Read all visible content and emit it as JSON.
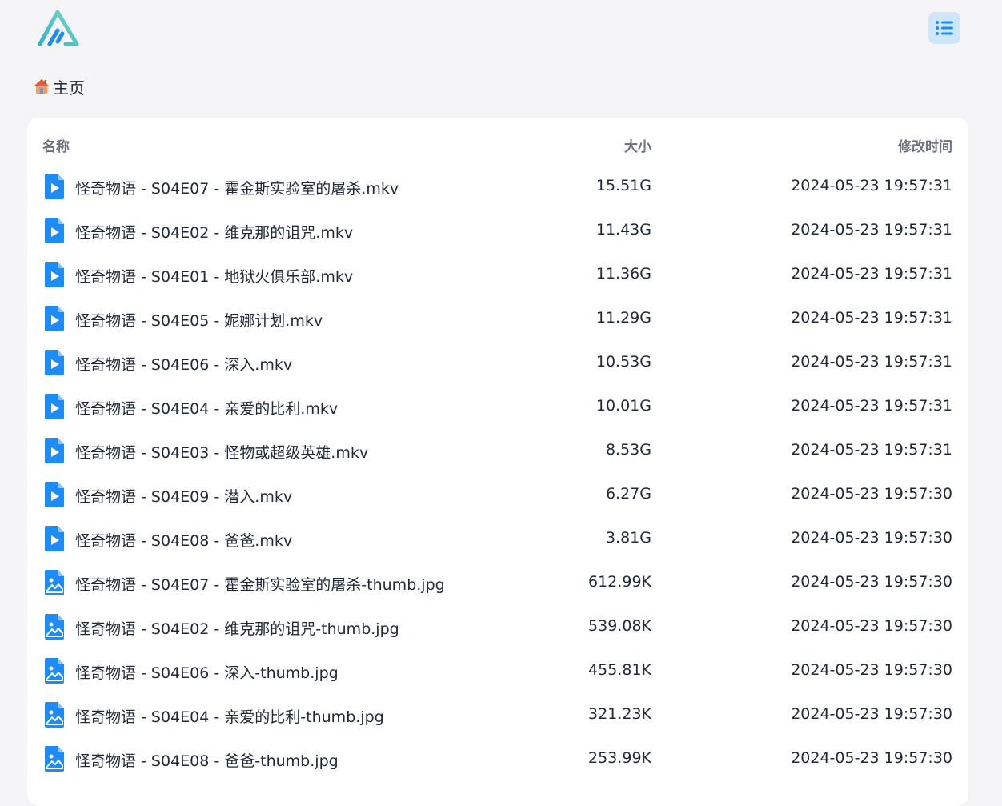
{
  "header": {
    "logo_icon": "app-logo-icon",
    "menu_icon": "list-menu-icon"
  },
  "breadcrumb": {
    "home_icon": "house-icon",
    "label": "主页"
  },
  "table": {
    "columns": {
      "name": "名称",
      "size": "大小",
      "modified": "修改时间"
    },
    "rows": [
      {
        "name": "怪奇物语 - S04E07 - 霍金斯实验室的屠杀.mkv",
        "size": "15.51G",
        "modified": "2024-05-23 19:57:31",
        "icon": "video-file-icon"
      },
      {
        "name": "怪奇物语 - S04E02 - 维克那的诅咒.mkv",
        "size": "11.43G",
        "modified": "2024-05-23 19:57:31",
        "icon": "video-file-icon"
      },
      {
        "name": "怪奇物语 - S04E01 - 地狱火俱乐部.mkv",
        "size": "11.36G",
        "modified": "2024-05-23 19:57:31",
        "icon": "video-file-icon"
      },
      {
        "name": "怪奇物语 - S04E05 - 妮娜计划.mkv",
        "size": "11.29G",
        "modified": "2024-05-23 19:57:31",
        "icon": "video-file-icon"
      },
      {
        "name": "怪奇物语 - S04E06 - 深入.mkv",
        "size": "10.53G",
        "modified": "2024-05-23 19:57:31",
        "icon": "video-file-icon"
      },
      {
        "name": "怪奇物语 - S04E04 - 亲爱的比利.mkv",
        "size": "10.01G",
        "modified": "2024-05-23 19:57:31",
        "icon": "video-file-icon"
      },
      {
        "name": "怪奇物语 - S04E03 - 怪物或超级英雄.mkv",
        "size": "8.53G",
        "modified": "2024-05-23 19:57:31",
        "icon": "video-file-icon"
      },
      {
        "name": "怪奇物语 - S04E09 - 潜入.mkv",
        "size": "6.27G",
        "modified": "2024-05-23 19:57:30",
        "icon": "video-file-icon"
      },
      {
        "name": "怪奇物语 - S04E08 - 爸爸.mkv",
        "size": "3.81G",
        "modified": "2024-05-23 19:57:30",
        "icon": "video-file-icon"
      },
      {
        "name": "怪奇物语 - S04E07 - 霍金斯实验室的屠杀-thumb.jpg",
        "size": "612.99K",
        "modified": "2024-05-23 19:57:30",
        "icon": "image-file-icon"
      },
      {
        "name": "怪奇物语 - S04E02 - 维克那的诅咒-thumb.jpg",
        "size": "539.08K",
        "modified": "2024-05-23 19:57:30",
        "icon": "image-file-icon"
      },
      {
        "name": "怪奇物语 - S04E06 - 深入-thumb.jpg",
        "size": "455.81K",
        "modified": "2024-05-23 19:57:30",
        "icon": "image-file-icon"
      },
      {
        "name": "怪奇物语 - S04E04 - 亲爱的比利-thumb.jpg",
        "size": "321.23K",
        "modified": "2024-05-23 19:57:30",
        "icon": "image-file-icon"
      },
      {
        "name": "怪奇物语 - S04E08 - 爸爸-thumb.jpg",
        "size": "253.99K",
        "modified": "2024-05-23 19:57:30",
        "icon": "image-file-icon"
      }
    ]
  },
  "colors": {
    "accent": "#1d8cf8",
    "menu_bg": "#cfe6fb",
    "page_bg": "#f5f5f7",
    "header_text": "#6b7280"
  }
}
